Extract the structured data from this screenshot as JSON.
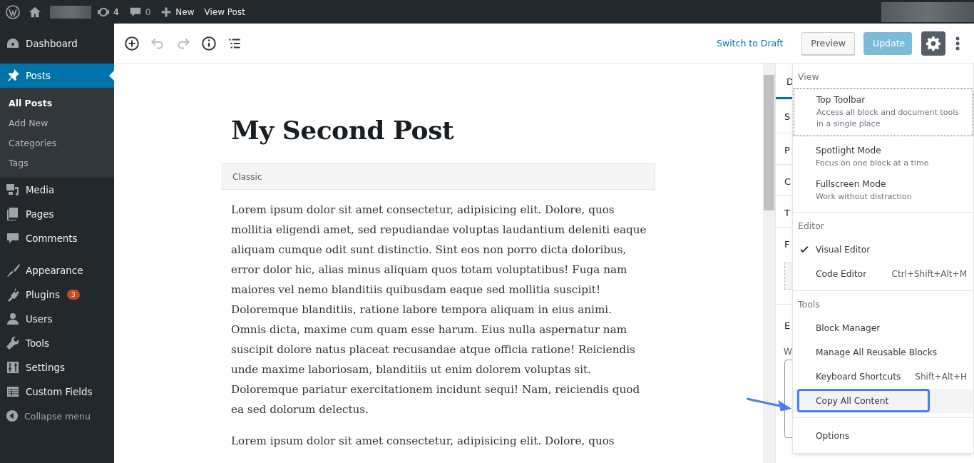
{
  "admin_bar": {
    "updates": "4",
    "comments": "0",
    "new": "New",
    "view": "View Post"
  },
  "sidebar": {
    "items": [
      {
        "label": "Dashboard",
        "selected": false
      },
      {
        "label": "Posts",
        "selected": true,
        "children": [
          {
            "label": "All Posts",
            "selected": true
          },
          {
            "label": "Add New",
            "selected": false
          },
          {
            "label": "Categories",
            "selected": false
          },
          {
            "label": "Tags",
            "selected": false
          }
        ]
      },
      {
        "label": "Media",
        "selected": false
      },
      {
        "label": "Pages",
        "selected": false
      },
      {
        "label": "Comments",
        "selected": false
      },
      {
        "label": "Appearance",
        "selected": false
      },
      {
        "label": "Plugins",
        "selected": false,
        "badge": "3"
      },
      {
        "label": "Users",
        "selected": false
      },
      {
        "label": "Tools",
        "selected": false
      },
      {
        "label": "Settings",
        "selected": false
      },
      {
        "label": "Custom Fields",
        "selected": false
      }
    ],
    "collapse": "Collapse menu"
  },
  "toolbar": {
    "tools": [
      {
        "disabled": false
      },
      {
        "disabled": true
      },
      {
        "disabled": true
      },
      {
        "disabled": false
      },
      {
        "disabled": false
      }
    ],
    "switch_to_draft": "Switch to Draft",
    "preview": "Preview",
    "update": {
      "label": "Update",
      "disabled": true
    },
    "settings_pressed": true
  },
  "post": {
    "title": "My Second Post",
    "block_label": "Classic",
    "paragraphs": [
      "Lorem ipsum dolor sit amet consectetur, adipisicing elit. Dolore, quos mollitia eligendi amet, sed repudiandae voluptas laudantium deleniti eaque aliquam cumque odit sunt distinctio. Sint eos non porro dicta doloribus, error dolor hic, alias minus aliquam quos totam voluptatibus! Fuga nam maiores vel nemo blanditiis quibusdam eaque sed mollitia suscipit! Doloremque blanditiis, ratione labore tempora aliquam in eius animi. Omnis dicta, maxime cum quam esse harum. Eius nulla aspernatur nam suscipit dolore natus placeat recusandae atque officia ratione! Reiciendis unde maxime laboriosam, blanditiis ut enim dolorem voluptas sit. Doloremque pariatur exercitationem incidunt sequi! Nam, reiciendis quod ea sed dolorum delectus.",
      "Lorem ipsum dolor sit amet consectetur, adipisicing elit. Dolore, quos"
    ]
  },
  "settings_panel": {
    "tab": "D",
    "sections": [
      "S",
      "P",
      "C",
      "T",
      "F",
      "E"
    ],
    "excerpt_label": "W"
  },
  "more_menu": {
    "groups": [
      {
        "label": "View",
        "items": [
          {
            "title": "Top Toolbar",
            "description": "Access all block and document tools in a single place",
            "checked": false,
            "focused": true,
            "hovered": false
          },
          {
            "title": "Spotlight Mode",
            "description": "Focus on one block at a time",
            "checked": false,
            "focused": false,
            "hovered": false
          },
          {
            "title": "Fullscreen Mode",
            "description": "Work without distraction",
            "checked": false,
            "focused": false,
            "hovered": false
          }
        ]
      },
      {
        "label": "Editor",
        "items": [
          {
            "title": "Visual Editor",
            "checked": true,
            "focused": false,
            "hovered": false
          },
          {
            "title": "Code Editor",
            "shortcut": "Ctrl+Shift+Alt+M",
            "checked": false,
            "focused": false,
            "hovered": false
          }
        ]
      },
      {
        "label": "Tools",
        "items": [
          {
            "title": "Block Manager",
            "checked": false,
            "focused": false,
            "hovered": false
          },
          {
            "title": "Manage All Reusable Blocks",
            "checked": false,
            "focused": false,
            "hovered": false
          },
          {
            "title": "Keyboard Shortcuts",
            "shortcut": "Shift+Alt+H",
            "checked": false,
            "focused": false,
            "hovered": false
          },
          {
            "title": "Copy All Content",
            "checked": false,
            "focused": false,
            "hovered": true,
            "annotated": true
          }
        ]
      },
      {
        "items": [
          {
            "title": "Options",
            "checked": false,
            "focused": false,
            "hovered": false
          }
        ]
      }
    ]
  }
}
